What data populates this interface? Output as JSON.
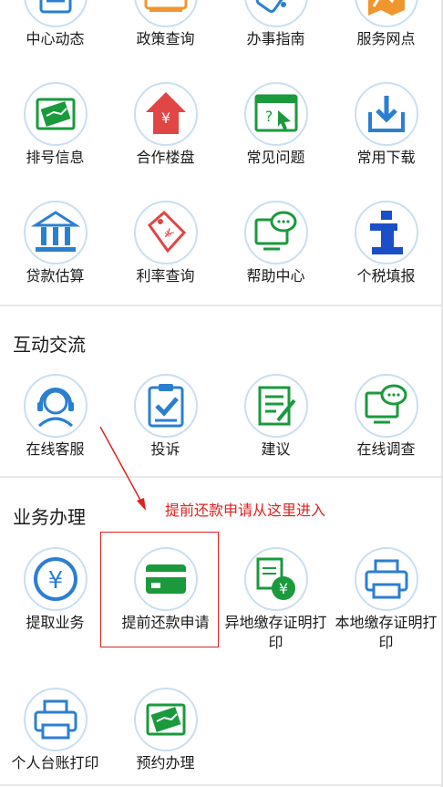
{
  "top_row": [
    {
      "label": "中心动态",
      "icon": "news-icon"
    },
    {
      "label": "政策查询",
      "icon": "policy-icon"
    },
    {
      "label": "办事指南",
      "icon": "guide-icon"
    },
    {
      "label": "服务网点",
      "icon": "map-icon"
    }
  ],
  "row2": [
    {
      "label": "排号信息",
      "icon": "queue-ticket-icon"
    },
    {
      "label": "合作楼盘",
      "icon": "building-yuan-icon"
    },
    {
      "label": "常见问题",
      "icon": "faq-icon"
    },
    {
      "label": "常用下载",
      "icon": "download-icon"
    }
  ],
  "row3": [
    {
      "label": "贷款估算",
      "icon": "bank-icon"
    },
    {
      "label": "利率查询",
      "icon": "price-tag-icon"
    },
    {
      "label": "帮助中心",
      "icon": "help-chat-icon"
    },
    {
      "label": "个税填报",
      "icon": "info-icon"
    }
  ],
  "interaction": {
    "title": "互动交流",
    "items": [
      {
        "label": "在线客服",
        "icon": "headset-icon"
      },
      {
        "label": "投诉",
        "icon": "complaint-clipboard-icon"
      },
      {
        "label": "建议",
        "icon": "suggestion-doc-icon"
      },
      {
        "label": "在线调查",
        "icon": "survey-chat-icon"
      }
    ]
  },
  "business": {
    "title": "业务办理",
    "items": [
      {
        "label": "提取业务",
        "icon": "yuan-coin-icon"
      },
      {
        "label": "提前还款申请",
        "icon": "card-icon"
      },
      {
        "label": "异地缴存证明打印",
        "icon": "doc-yuan-icon"
      },
      {
        "label": "本地缴存证明打印",
        "icon": "printer-icon"
      },
      {
        "label": "个人台账打印",
        "icon": "printer-icon"
      },
      {
        "label": "预约办理",
        "icon": "appointment-icon"
      }
    ]
  },
  "annotation": {
    "text": "提前还款申请从这里进入"
  },
  "colors": {
    "accent_green": "#1a9a3c",
    "accent_blue": "#2b7fd0",
    "annotation_red": "#e02020",
    "icon_ring": "#c9dff0"
  }
}
